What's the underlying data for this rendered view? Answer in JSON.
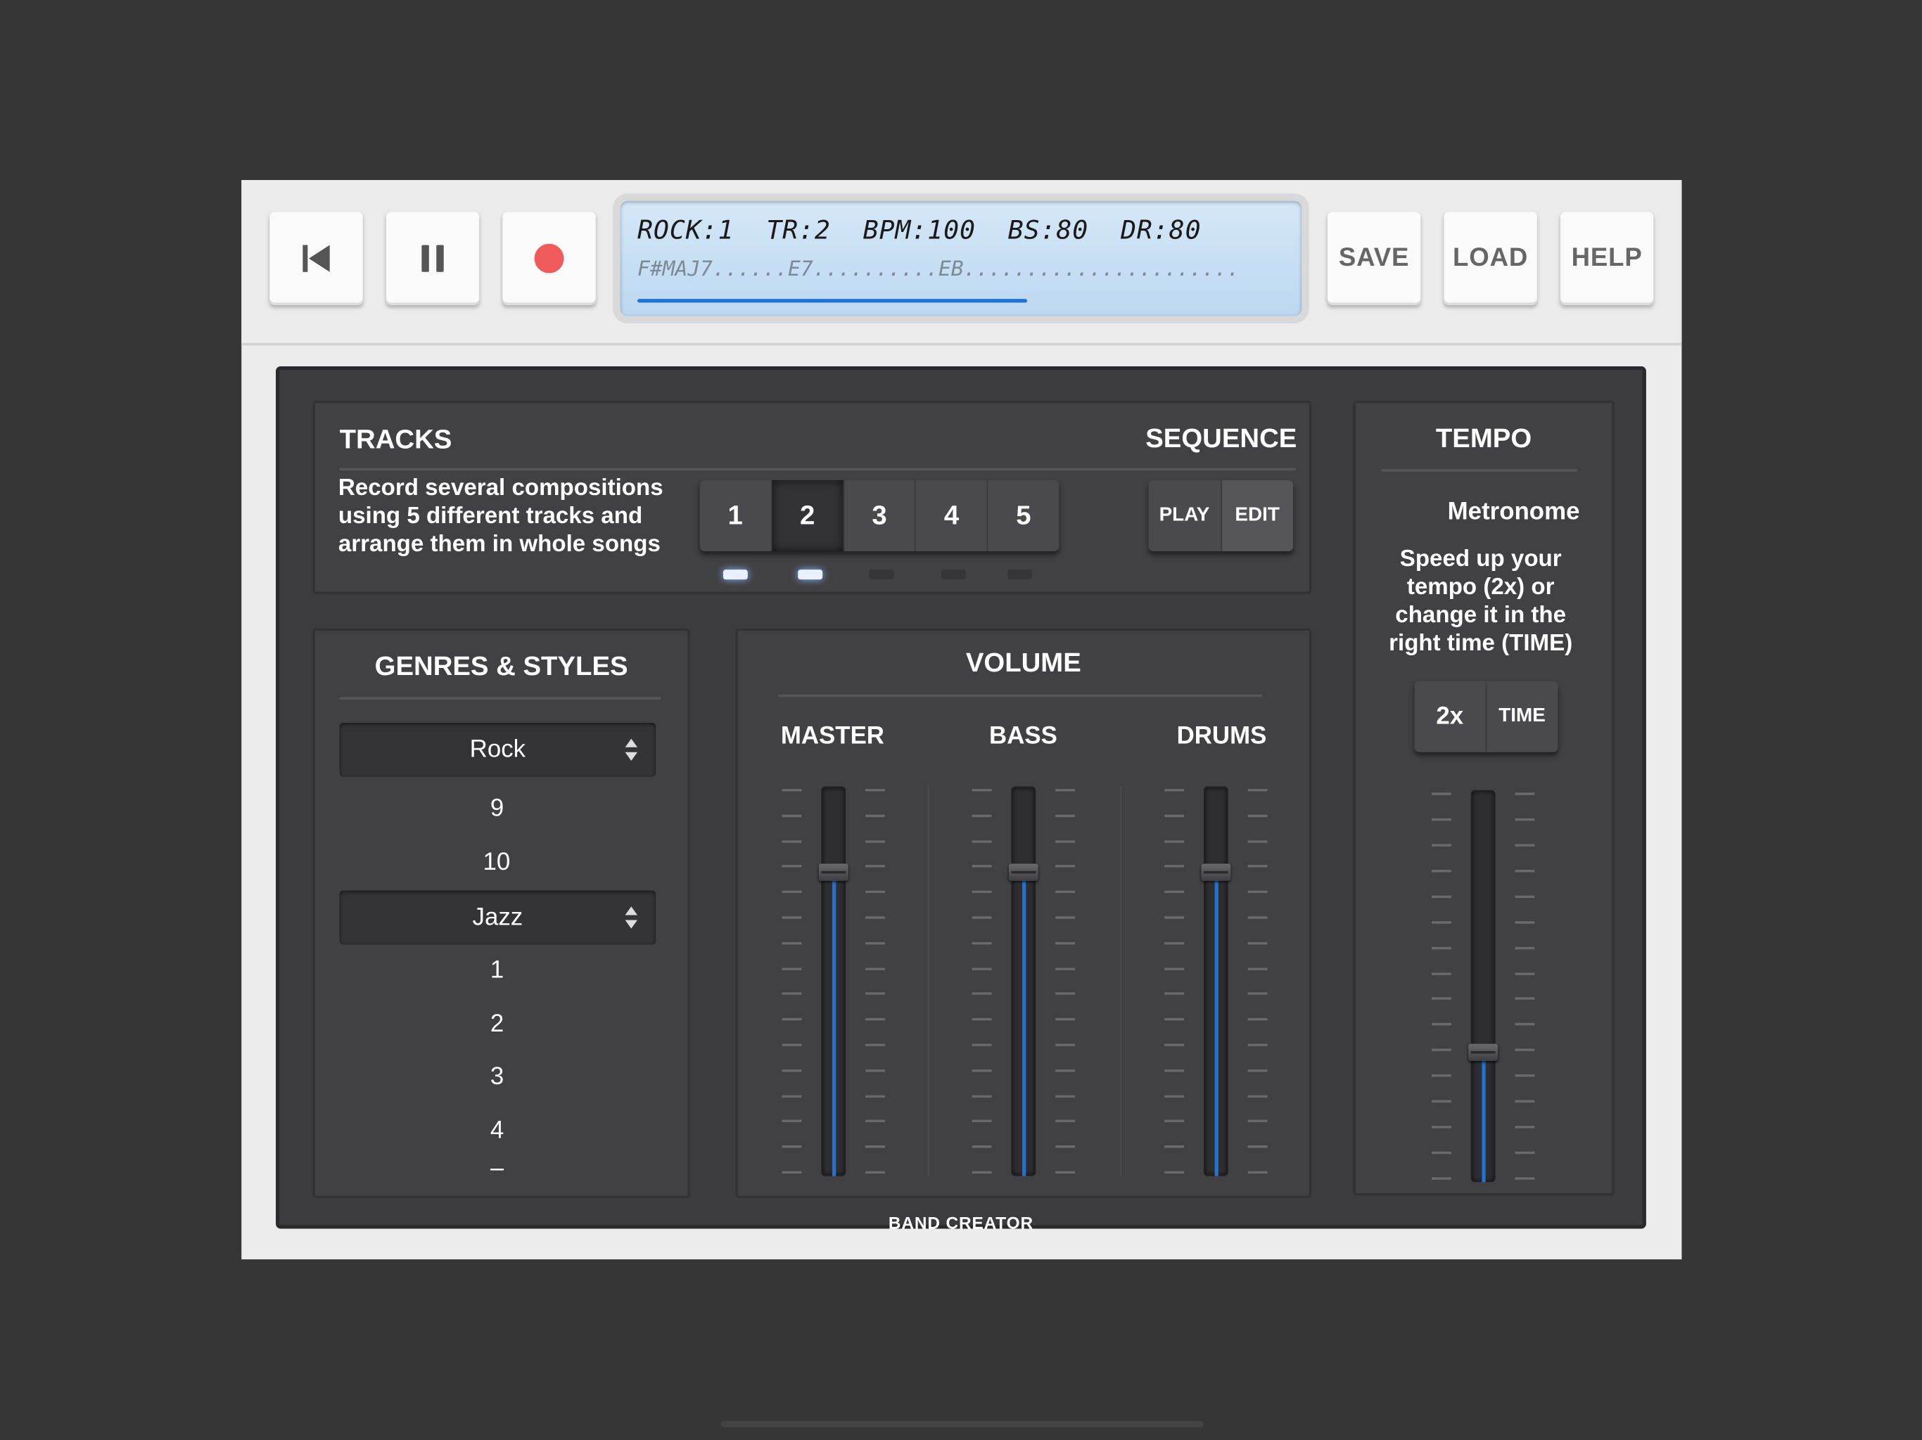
{
  "toolbar": {
    "save": "SAVE",
    "load": "LOAD",
    "help": "HELP",
    "record_color": "#f05a5a"
  },
  "display": {
    "line1": "ROCK:1  TR:2  BPM:100  BS:80  DR:80",
    "line2": "F#MAJ7......E7..........EB......................",
    "progress": 0.6,
    "accent": "#1e73d8"
  },
  "tracks": {
    "title": "TRACKS",
    "sequence_title": "SEQUENCE",
    "description": "Record several compositions using 5 different tracks and arrange them in whole songs",
    "buttons": [
      "1",
      "2",
      "3",
      "4",
      "5"
    ],
    "active": "2",
    "leds_on": [
      true,
      true,
      false,
      false,
      false
    ],
    "play": "PLAY",
    "edit": "EDIT"
  },
  "genres": {
    "title": "GENRES & STYLES",
    "select1": "Rock",
    "list1": [
      "9",
      "10"
    ],
    "select2": "Jazz",
    "list2": [
      "1",
      "2",
      "3",
      "4",
      "–"
    ]
  },
  "volume": {
    "title": "VOLUME",
    "master": "MASTER",
    "bass": "BASS",
    "drums": "DRUMS",
    "master_level": 0.78,
    "bass_level": 0.78,
    "drums_level": 0.78
  },
  "tempo": {
    "title": "TEMPO",
    "subtitle": "Metronome",
    "description": "Speed up your tempo (2x) or change it in the right time (TIME)",
    "double": "2x",
    "time": "TIME",
    "level": 0.33
  },
  "footer": {
    "brand": "BAND CREATOR"
  }
}
